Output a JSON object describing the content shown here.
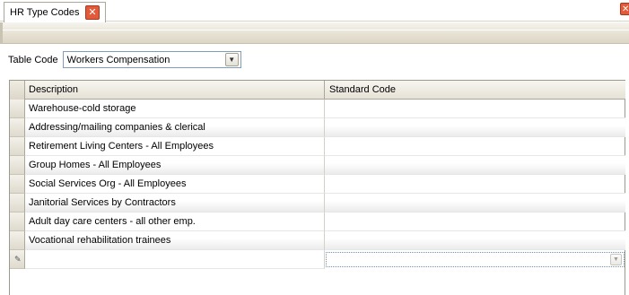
{
  "tab": {
    "label": "HR Type Codes",
    "close_glyph": "✕"
  },
  "window": {
    "close_glyph": "✕"
  },
  "filter": {
    "label": "Table Code",
    "selected": "Workers Compensation"
  },
  "grid": {
    "columns": [
      "Description",
      "Standard Code"
    ],
    "rows": [
      {
        "description": "Warehouse-cold storage",
        "standard_code": ""
      },
      {
        "description": "Addressing/mailing companies & clerical",
        "standard_code": ""
      },
      {
        "description": "Retirement Living Centers - All Employees",
        "standard_code": ""
      },
      {
        "description": "Group Homes - All Employees",
        "standard_code": ""
      },
      {
        "description": "Social Services Org - All Employees",
        "standard_code": ""
      },
      {
        "description": "Janitorial Services by Contractors",
        "standard_code": ""
      },
      {
        "description": "Adult day care centers - all other emp.",
        "standard_code": ""
      },
      {
        "description": "Vocational rehabilitation trainees",
        "standard_code": ""
      }
    ],
    "new_row": {
      "description": "",
      "standard_code": ""
    }
  },
  "icons": {
    "dropdown": "chevron-down-icon",
    "new_row": "pencil-icon",
    "close": "close-icon"
  }
}
